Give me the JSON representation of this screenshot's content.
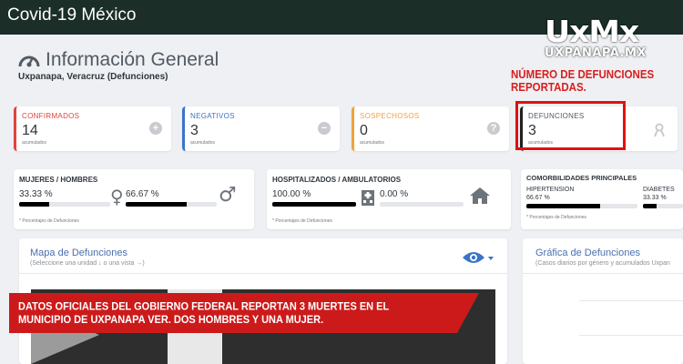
{
  "app": {
    "title": "Covid-19 México"
  },
  "logo": {
    "main": "UxMx",
    "sub": "UXPANAPA.MX"
  },
  "section": {
    "title": "Información General",
    "location": "Uxpanapa, Veracruz (Defunciones)"
  },
  "annotation_top": "NÚMERO DE DEFUNCIONES REPORTADAS.",
  "stats": [
    {
      "label": "CONFIRMADOS",
      "value": "14",
      "sub": "acumulados",
      "icon": "plus-icon",
      "icon_glyph": "+",
      "color": "#e0443c"
    },
    {
      "label": "NEGATIVOS",
      "value": "3",
      "sub": "acumulados",
      "icon": "minus-icon",
      "icon_glyph": "−",
      "color": "#3b73c9"
    },
    {
      "label": "SOSPECHOSOS",
      "value": "0",
      "sub": "acumulados",
      "icon": "question-icon",
      "icon_glyph": "?",
      "color": "#f0a33a"
    },
    {
      "label": "DEFUNCIONES",
      "value": "3",
      "sub": "acumulados",
      "icon": "ribbon-icon",
      "icon_glyph": "",
      "color": "#222222"
    }
  ],
  "gender": {
    "title": "MUJERES / HOMBRES",
    "women_pct": "33.33 %",
    "men_pct": "66.67 %",
    "women_fill": 0.3333,
    "men_fill": 0.6667,
    "note": "* Porcentajes de Defunciones",
    "women_icon": "female-icon",
    "men_icon": "male-icon"
  },
  "hospital": {
    "title": "HOSPITALIZADOS / AMBULATORIOS",
    "hosp_pct": "100.00 %",
    "amb_pct": "0.00 %",
    "hosp_fill": 1.0,
    "amb_fill": 0.0,
    "note": "* Porcentajes de Defunciones",
    "hosp_icon": "hospital-icon",
    "amb_icon": "house-icon"
  },
  "comorbidities": {
    "title": "COMORBILIDADES PRINCIPALES",
    "items": [
      {
        "label": "HIPERTENSION",
        "pct": "66.67 %",
        "fill": 0.6667
      },
      {
        "label": "DIABETES",
        "pct": "33.33 %",
        "fill": 0.3333
      }
    ],
    "note": "* Porcentajes de Defunciones"
  },
  "map_panel": {
    "title": "Mapa de Defunciones",
    "subtitle": "(Seleccione una unidad ↓ o una vista →)",
    "icon": "eye-icon"
  },
  "chart_panel": {
    "title": "Gráfica de Defunciones",
    "subtitle": "(Casos diarios por género y acumulados Uxpan"
  },
  "banner": "DATOS OFICIALES DEL GOBIERNO FEDERAL REPORTAN 3 MUERTES EN EL MUNICIPIO DE UXPANAPA VER. DOS HOMBRES Y UNA MUJER.",
  "colors": {
    "topbar": "#1b2e28",
    "annotation": "#d81e1e",
    "panel_title": "#4a6fb0"
  }
}
